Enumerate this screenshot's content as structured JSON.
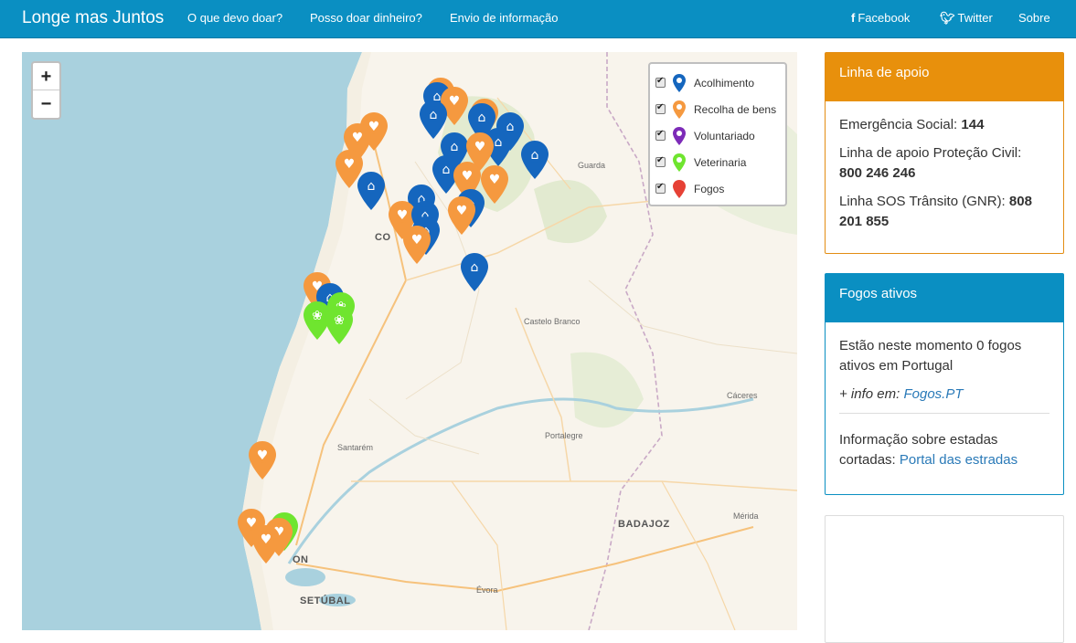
{
  "navbar": {
    "brand": "Longe mas Juntos",
    "links": [
      "O que devo doar?",
      "Posso doar dinheiro?",
      "Envio de informação"
    ],
    "facebook": "Facebook",
    "twitter": "Twitter",
    "about": "Sobre"
  },
  "map": {
    "zoom_in": "+",
    "zoom_out": "−",
    "cities": {
      "guarda": "Guarda",
      "coimbra": "CO",
      "castelo_branco": "Castelo Branco",
      "caceres": "Cáceres",
      "portalegre": "Portalegre",
      "santarem": "Santarém",
      "badajoz": "BADAJOZ",
      "merida": "Mérida",
      "lisboa": "ON",
      "evora": "Évora",
      "setubal": "SETÚBAL"
    },
    "legend": [
      {
        "label": "Acolhimento",
        "color": "#1566be",
        "icon": "home-icon"
      },
      {
        "label": "Recolha de bens",
        "color": "#f5993f",
        "icon": "heart-hand-icon"
      },
      {
        "label": "Voluntariado",
        "color": "#7d2bb8",
        "icon": "volunteer-icon"
      },
      {
        "label": "Veterinaria",
        "color": "#6fe52f",
        "icon": "paw-icon"
      },
      {
        "label": "Fogos",
        "color": "#e64135",
        "icon": "fire-pin-icon"
      }
    ]
  },
  "support": {
    "title": "Linha de apoio",
    "social_label": "Emergência Social:",
    "social_number": "144",
    "civil_label": "Linha de apoio Proteção Civil:",
    "civil_number": "800 246 246",
    "sos_label": "Linha SOS Trânsito (GNR):",
    "sos_number": "808 201 855"
  },
  "fires": {
    "title": "Fogos ativos",
    "status": "Estão neste momento 0 fogos ativos em Portugal",
    "info_prefix": "+ info em:",
    "info_link": "Fogos.PT",
    "roads_text": "Informação sobre estadas cortadas:",
    "roads_link": "Portal das estradas"
  }
}
